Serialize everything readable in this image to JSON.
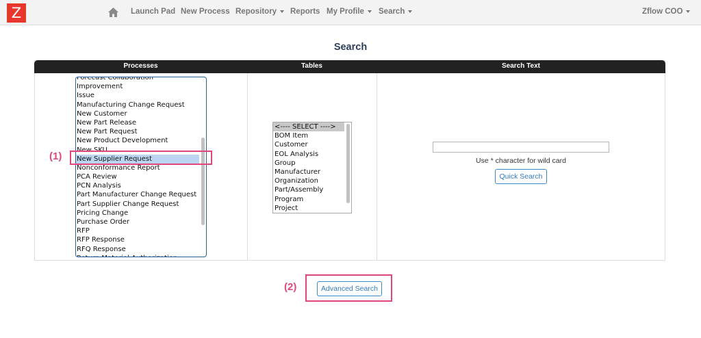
{
  "app": {
    "logo_letter": "Z",
    "brand_color": "#e8372c"
  },
  "nav": {
    "items": [
      {
        "label": "Launch Pad",
        "dropdown": false
      },
      {
        "label": "New Process",
        "dropdown": false
      },
      {
        "label": "Repository",
        "dropdown": true
      },
      {
        "label": "Reports",
        "dropdown": false
      },
      {
        "label": "My Profile",
        "dropdown": true
      },
      {
        "label": "Search",
        "dropdown": true
      }
    ],
    "user": "Zflow COO"
  },
  "page": {
    "title": "Search"
  },
  "columns": {
    "processes": "Processes",
    "tables": "Tables",
    "search_text": "Search Text"
  },
  "processes": {
    "items": [
      "Forecast Collaboration",
      "Improvement",
      "Issue",
      "Manufacturing Change Request",
      "New Customer",
      "New Part Release",
      "New Part Request",
      "New Product Development",
      "New SKU",
      "New Supplier Request",
      "Nonconformance Report",
      "PCA Review",
      "PCN Analysis",
      "Part Manufacturer Change Request",
      "Part Supplier Change Request",
      "Pricing Change",
      "Purchase Order",
      "RFP",
      "RFP Response",
      "RFQ Response",
      "Return Material Authorization"
    ],
    "selected": "New Supplier Request"
  },
  "tables": {
    "items": [
      "<---- SELECT ---->",
      "BOM Item",
      "Customer",
      "EOL Analysis",
      "Group",
      "Manufacturer",
      "Organization",
      "Part/Assembly",
      "Program",
      "Project"
    ],
    "selected": "<---- SELECT ---->"
  },
  "search": {
    "value": "",
    "hint": "Use * character for wild card",
    "quick_label": "Quick Search",
    "advanced_label": "Advanced Search"
  },
  "annotations": {
    "label_1": "(1)",
    "label_2": "(2)",
    "color": "#e0457b"
  }
}
